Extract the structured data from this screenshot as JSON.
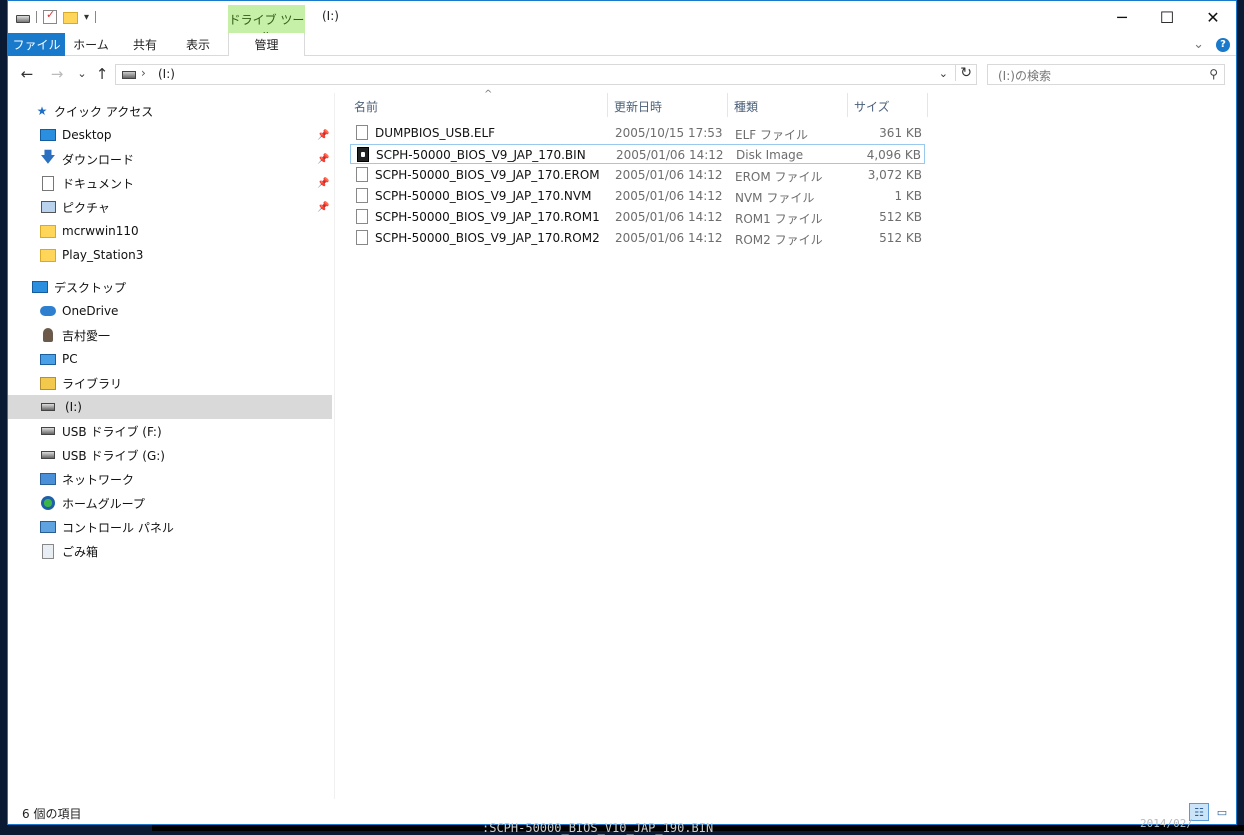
{
  "window": {
    "title": "(I:)",
    "context_tab_group": "ドライブ ツール",
    "controls": {
      "minimize": "─",
      "maximize": "☐",
      "close": "✕"
    }
  },
  "ribbon": {
    "tabs": [
      {
        "label": "ファイル"
      },
      {
        "label": "ホーム"
      },
      {
        "label": "共有"
      },
      {
        "label": "表示"
      },
      {
        "label": "管理"
      }
    ],
    "collapse_glyph": "⌄",
    "help_glyph": "?"
  },
  "navigation": {
    "back": "←",
    "forward": "→",
    "recent": "⌄",
    "up": "↑",
    "address_chevron": "›",
    "address_path": "(I:)",
    "address_dropdown": "⌄",
    "refresh": "↻",
    "search_placeholder": "(I:)の検索",
    "search_glyph": "⚲"
  },
  "sidebar": {
    "quick_access": "クイック アクセス",
    "quick_items": [
      {
        "label": "Desktop",
        "icon": "desktop-folder-icon",
        "pinned": true
      },
      {
        "label": "ダウンロード",
        "icon": "download-icon",
        "pinned": true
      },
      {
        "label": "ドキュメント",
        "icon": "document-icon",
        "pinned": true
      },
      {
        "label": "ピクチャ",
        "icon": "picture-icon",
        "pinned": true
      },
      {
        "label": "mcrwwin110",
        "icon": "folder-icon",
        "pinned": false
      },
      {
        "label": "Play_Station3",
        "icon": "folder-icon",
        "pinned": false
      }
    ],
    "desktop": "デスクトップ",
    "tree_items": [
      {
        "label": "OneDrive",
        "icon": "onedrive-icon"
      },
      {
        "label": "吉村愛一",
        "icon": "user-icon"
      },
      {
        "label": "PC",
        "icon": "pc-icon"
      },
      {
        "label": "ライブラリ",
        "icon": "library-icon"
      },
      {
        "label": "(I:)",
        "icon": "drive-icon",
        "selected": true
      },
      {
        "label": "USB ドライブ (F:)",
        "icon": "usb-drive-icon"
      },
      {
        "label": "USB ドライブ (G:)",
        "icon": "usb-drive-icon"
      },
      {
        "label": "ネットワーク",
        "icon": "network-icon"
      },
      {
        "label": "ホームグループ",
        "icon": "homegroup-icon"
      },
      {
        "label": "コントロール パネル",
        "icon": "control-panel-icon"
      },
      {
        "label": "ごみ箱",
        "icon": "recycle-bin-icon"
      }
    ]
  },
  "file_list": {
    "columns": [
      "名前",
      "更新日時",
      "種類",
      "サイズ"
    ],
    "sort_glyph": "^",
    "rows": [
      {
        "name": "DUMPBIOS_USB.ELF",
        "date": "2005/10/15 17:53",
        "type": "ELF ファイル",
        "size": "361 KB",
        "icon": "file-icon"
      },
      {
        "name": "SCPH-50000_BIOS_V9_JAP_170.BIN",
        "date": "2005/01/06 14:12",
        "type": "Disk Image",
        "size": "4,096 KB",
        "icon": "disk-image-icon",
        "selected": true
      },
      {
        "name": "SCPH-50000_BIOS_V9_JAP_170.EROM",
        "date": "2005/01/06 14:12",
        "type": "EROM ファイル",
        "size": "3,072 KB",
        "icon": "file-icon"
      },
      {
        "name": "SCPH-50000_BIOS_V9_JAP_170.NVM",
        "date": "2005/01/06 14:12",
        "type": "NVM ファイル",
        "size": "1 KB",
        "icon": "file-icon"
      },
      {
        "name": "SCPH-50000_BIOS_V9_JAP_170.ROM1",
        "date": "2005/01/06 14:12",
        "type": "ROM1 ファイル",
        "size": "512 KB",
        "icon": "file-icon"
      },
      {
        "name": "SCPH-50000_BIOS_V9_JAP_170.ROM2",
        "date": "2005/01/06 14:12",
        "type": "ROM2 ファイル",
        "size": "512 KB",
        "icon": "file-icon"
      }
    ]
  },
  "status": {
    "item_count": "6 個の項目",
    "details_view": "☷",
    "large_icons_view": "▭"
  },
  "background": {
    "text": ":SCPH-50000_BIOS_V10_JAP_190.BIN",
    "text2": "2014/02/"
  },
  "colors": {
    "accent": "#1979ca",
    "context_tab": "#c6efa8",
    "selection": "#d9d9d9"
  }
}
